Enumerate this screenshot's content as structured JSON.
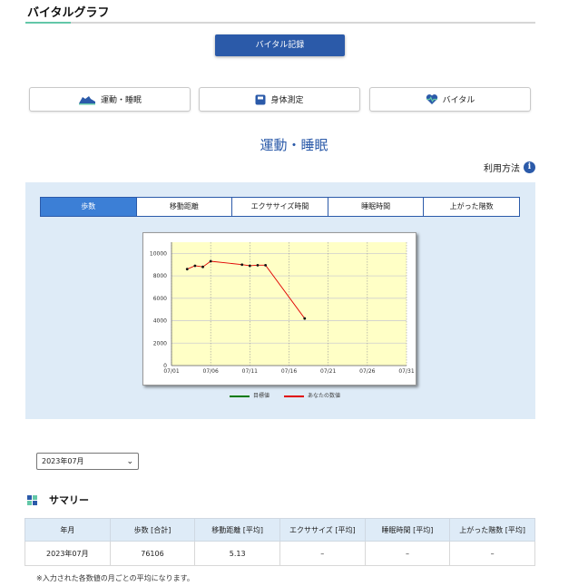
{
  "page": {
    "title": "バイタルグラフ"
  },
  "vital_record_button": "バイタル記録",
  "categories": [
    {
      "label": "運動・睡眠",
      "icon": "shoe-icon"
    },
    {
      "label": "身体測定",
      "icon": "scale-icon"
    },
    {
      "label": "バイタル",
      "icon": "heart-pulse-icon"
    }
  ],
  "section": {
    "title": "運動・睡眠",
    "usage_label": "利用方法",
    "info_glyph": "i"
  },
  "tabs": [
    {
      "label": "歩数",
      "active": true
    },
    {
      "label": "移動距離",
      "active": false
    },
    {
      "label": "エクササイズ時間",
      "active": false
    },
    {
      "label": "睡眠時間",
      "active": false
    },
    {
      "label": "上がった階数",
      "active": false
    }
  ],
  "chart_data": {
    "type": "line",
    "x_ticks": [
      "07/01",
      "07/06",
      "07/11",
      "07/16",
      "07/21",
      "07/26",
      "07/31"
    ],
    "y_ticks": [
      0,
      2000,
      4000,
      6000,
      8000,
      10000
    ],
    "ylim": [
      0,
      11000
    ],
    "xlim": [
      1,
      31
    ],
    "grid": true,
    "series": [
      {
        "name": "目標値",
        "color": "#007a00",
        "x": [],
        "y": []
      },
      {
        "name": "あなたの数値",
        "color": "#e00000",
        "x": [
          3,
          4,
          5,
          6,
          10,
          11,
          12,
          13,
          18
        ],
        "y": [
          8600,
          8900,
          8800,
          9300,
          9000,
          8900,
          8950,
          8950,
          4200
        ]
      }
    ],
    "legend_position": "bottom"
  },
  "month_select": {
    "value": "2023年07月",
    "chevron": "⌄"
  },
  "summary": {
    "title": "サマリー",
    "icon_colors": [
      "#2b5aa9",
      "#63c7a8",
      "#63c7a8",
      "#2b5aa9"
    ],
    "headers": [
      "年月",
      "歩数 [合計]",
      "移動距離 [平均]",
      "エクササイズ [平均]",
      "睡眠時間 [平均]",
      "上がった階数 [平均]"
    ],
    "rows": [
      [
        "2023年07月",
        "76106",
        "5.13",
        "–",
        "–",
        "–"
      ]
    ],
    "note": "※入力された各数値の月ごとの平均になります。"
  }
}
